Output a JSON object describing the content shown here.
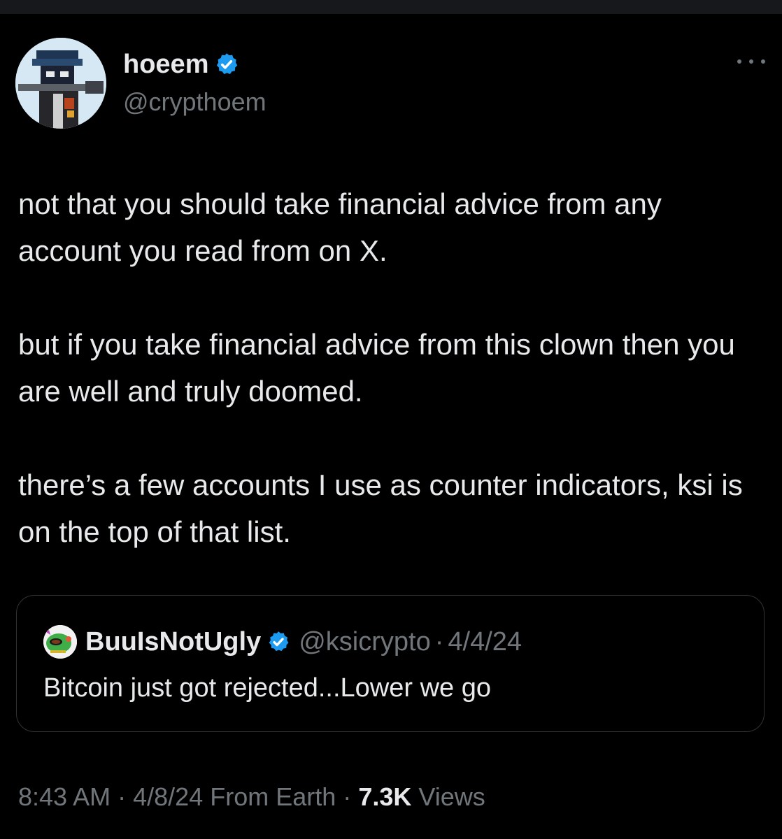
{
  "author": {
    "display_name": "hoeem",
    "handle": "@crypthoem",
    "verified_icon": "verified-badge-icon",
    "avatar_icon": "pixel-art-avatar"
  },
  "more_icon": "more-horizontal-icon",
  "tweet": {
    "paragraphs": [
      "not that you should take financial advice from any account you read from on X.",
      "but if you take financial advice from this clown then you are well and truly doomed.",
      "there’s a few accounts I use as counter indicators, ksi is on the top of that list."
    ]
  },
  "quote": {
    "display_name": "BuuIsNotUgly",
    "handle": "@ksicrypto",
    "separator": "·",
    "date": "4/4/24",
    "text": "Bitcoin just got rejected...Lower we go",
    "avatar_icon": "cartoon-avatar"
  },
  "meta": {
    "time": "8:43 AM",
    "sep1": "·",
    "date": "4/8/24",
    "source": "From Earth",
    "sep2": "·",
    "views_count": "7.3K",
    "views_label": "Views"
  },
  "colors": {
    "background": "#000000",
    "text": "#e7e9ea",
    "secondary": "#71767b",
    "verified": "#1d9bf0",
    "border": "#2f3336"
  }
}
